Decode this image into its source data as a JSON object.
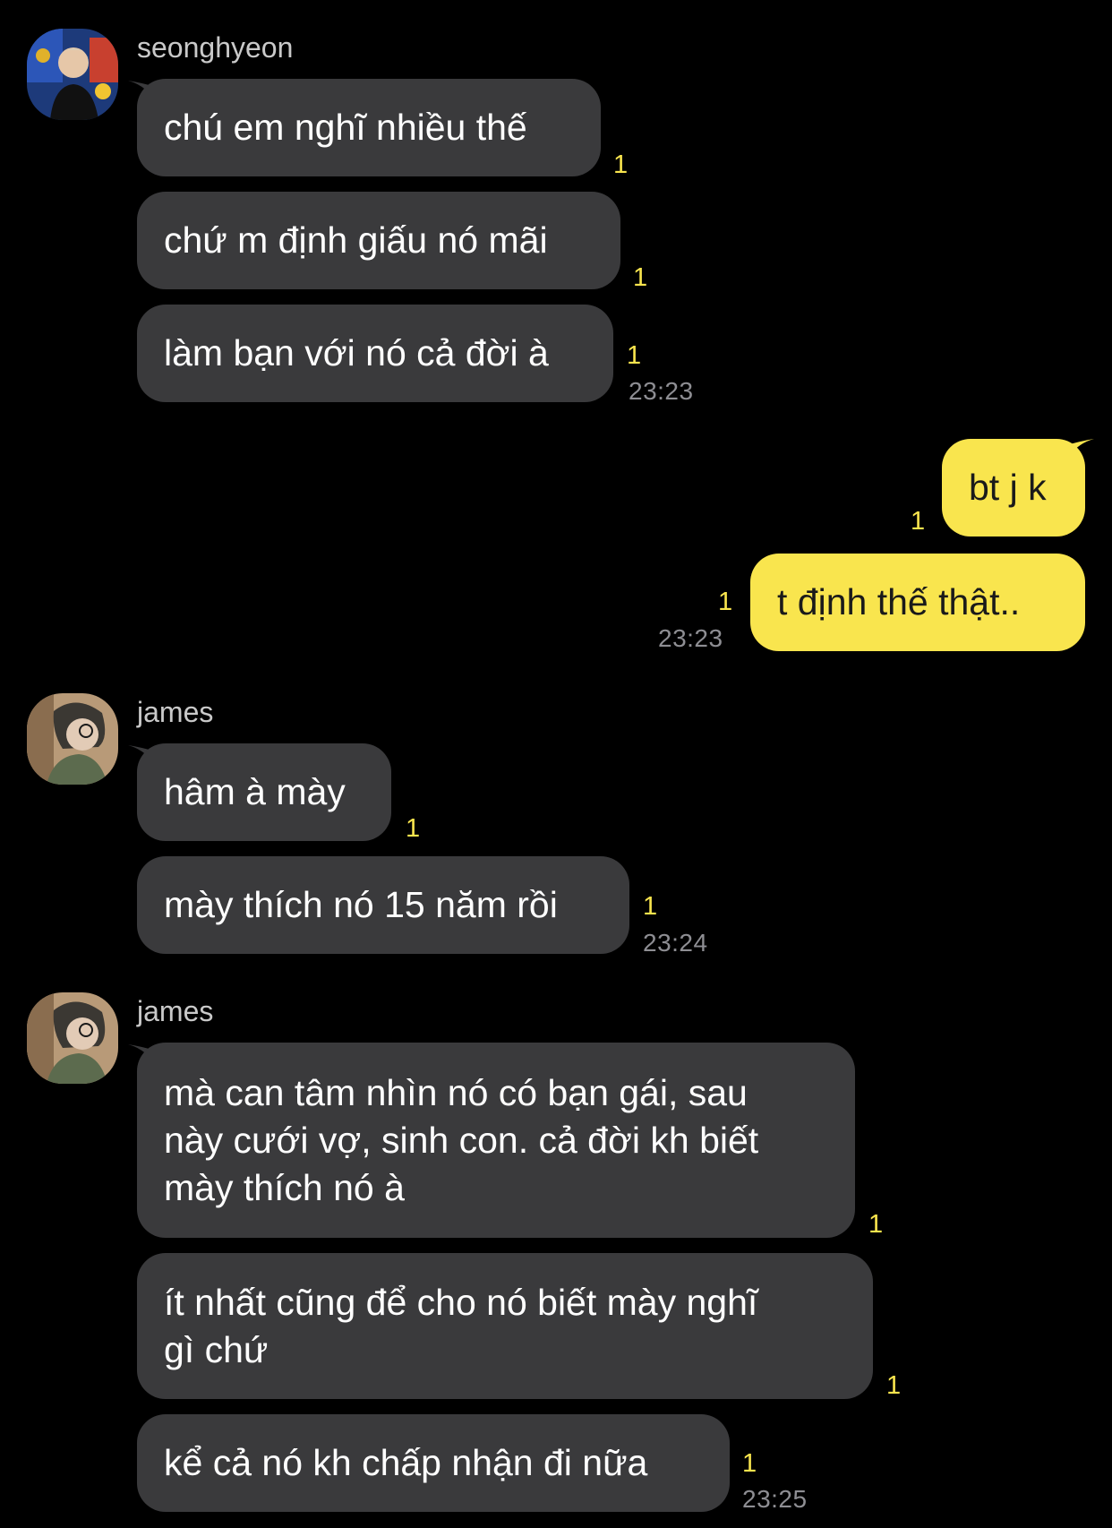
{
  "groups": [
    {
      "sender": "seonghyeon",
      "avatar": "seonghyeon-avatar-photo",
      "messages": [
        {
          "text": "chú em nghĩ nhiều thế",
          "unread": "1"
        },
        {
          "text": "chứ m định giấu nó mãi",
          "unread": "1"
        },
        {
          "text": "làm bạn với nó cả đời à",
          "unread": "1",
          "time": "23:23"
        }
      ]
    },
    {
      "sender": "me",
      "messages": [
        {
          "text": "bt j k",
          "unread": "1"
        },
        {
          "text": "t định thế thật..",
          "unread": "1",
          "time": "23:23"
        }
      ]
    },
    {
      "sender": "james",
      "avatar": "james-avatar-photo",
      "messages": [
        {
          "text": "hâm à mày",
          "unread": "1"
        },
        {
          "text": "mày thích nó 15 năm rồi",
          "unread": "1",
          "time": "23:24"
        }
      ]
    },
    {
      "sender": "james",
      "avatar": "james-avatar-photo",
      "messages": [
        {
          "lines": [
            "mà can tâm nhìn nó có bạn gái, sau",
            "này cưới vợ, sinh con. cả đời kh biết",
            "mày thích nó à"
          ],
          "unread": "1"
        },
        {
          "lines": [
            "ít nhất cũng để cho nó biết mày nghĩ",
            "gì chứ"
          ],
          "unread": "1"
        },
        {
          "text": "kể cả nó kh chấp nhận đi nữa",
          "unread": "1",
          "time": "23:25"
        }
      ]
    }
  ],
  "colors": {
    "background": "#000000",
    "incoming_bubble": "#3a3a3c",
    "outgoing_bubble": "#f9e54e",
    "unread_count": "#f9e54e",
    "timestamp": "#8e8e93"
  }
}
